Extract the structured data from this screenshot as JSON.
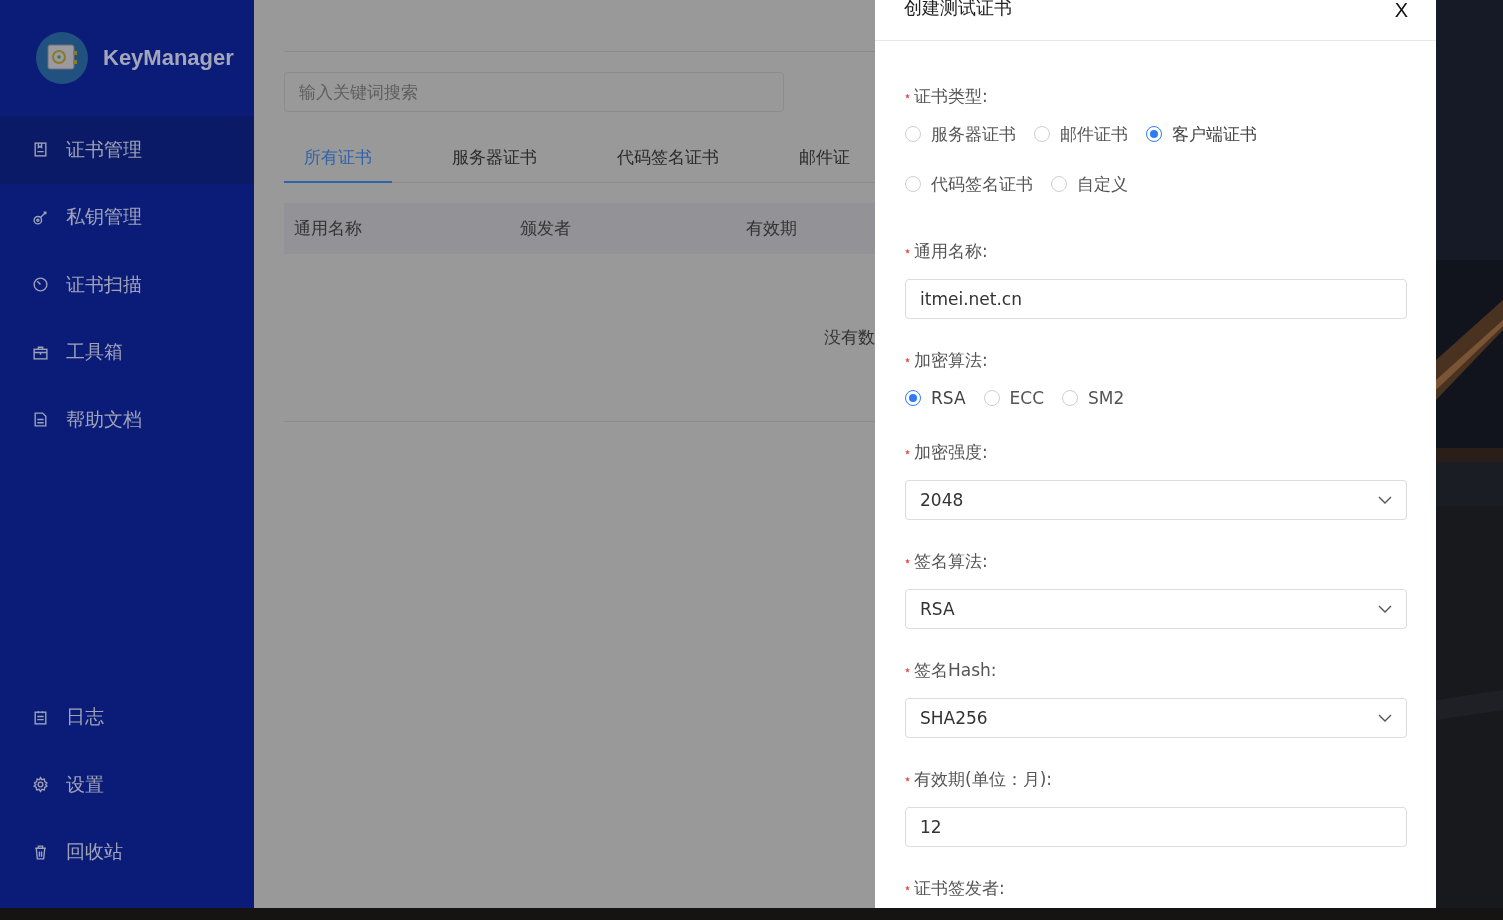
{
  "sidebar": {
    "app_name": "KeyManager",
    "items": [
      {
        "label": "证书管理",
        "selected": true
      },
      {
        "label": "私钥管理",
        "selected": false
      },
      {
        "label": "证书扫描",
        "selected": false
      },
      {
        "label": "工具箱",
        "selected": false
      },
      {
        "label": "帮助文档",
        "selected": false
      }
    ],
    "bottom_items": [
      {
        "label": "日志",
        "selected": false
      },
      {
        "label": "设置",
        "selected": false
      },
      {
        "label": "回收站",
        "selected": false
      }
    ]
  },
  "main": {
    "search": {
      "placeholder": "输入关键词搜索"
    },
    "tabs": [
      {
        "label": "所有证书",
        "selected": true
      },
      {
        "label": "服务器证书",
        "selected": false
      },
      {
        "label": "代码签名证书",
        "selected": false
      },
      {
        "label": "邮件证",
        "selected": false
      }
    ],
    "table": {
      "columns": [
        "通用名称",
        "颁发者",
        "有效期"
      ],
      "empty_text": "没有数"
    }
  },
  "drawer": {
    "title": "创建测试证书",
    "close": "X",
    "fields": [
      {
        "kind": "radio",
        "label": "证书类型:",
        "required": true,
        "options": [
          {
            "label": "服务器证书",
            "selected": false
          },
          {
            "label": "邮件证书",
            "selected": false
          },
          {
            "label": "客户端证书",
            "selected": true
          },
          {
            "label": "代码签名证书",
            "selected": false
          },
          {
            "label": "自定义",
            "selected": false
          }
        ]
      },
      {
        "kind": "input",
        "label": "通用名称:",
        "required": true,
        "value": "itmei.net.cn"
      },
      {
        "kind": "radio",
        "label": "加密算法:",
        "required": true,
        "options": [
          {
            "label": "RSA",
            "selected": true
          },
          {
            "label": "ECC",
            "selected": false
          },
          {
            "label": "SM2",
            "selected": false
          }
        ]
      },
      {
        "kind": "select",
        "label": "加密强度:",
        "required": true,
        "value": "2048"
      },
      {
        "kind": "select",
        "label": "签名算法:",
        "required": true,
        "value": "RSA"
      },
      {
        "kind": "select",
        "label": "签名Hash:",
        "required": true,
        "value": "SHA256"
      },
      {
        "kind": "input",
        "label": "有效期(单位：月):",
        "required": true,
        "value": "12"
      },
      {
        "kind": "label",
        "label": "证书签发者:",
        "required": true
      }
    ]
  }
}
